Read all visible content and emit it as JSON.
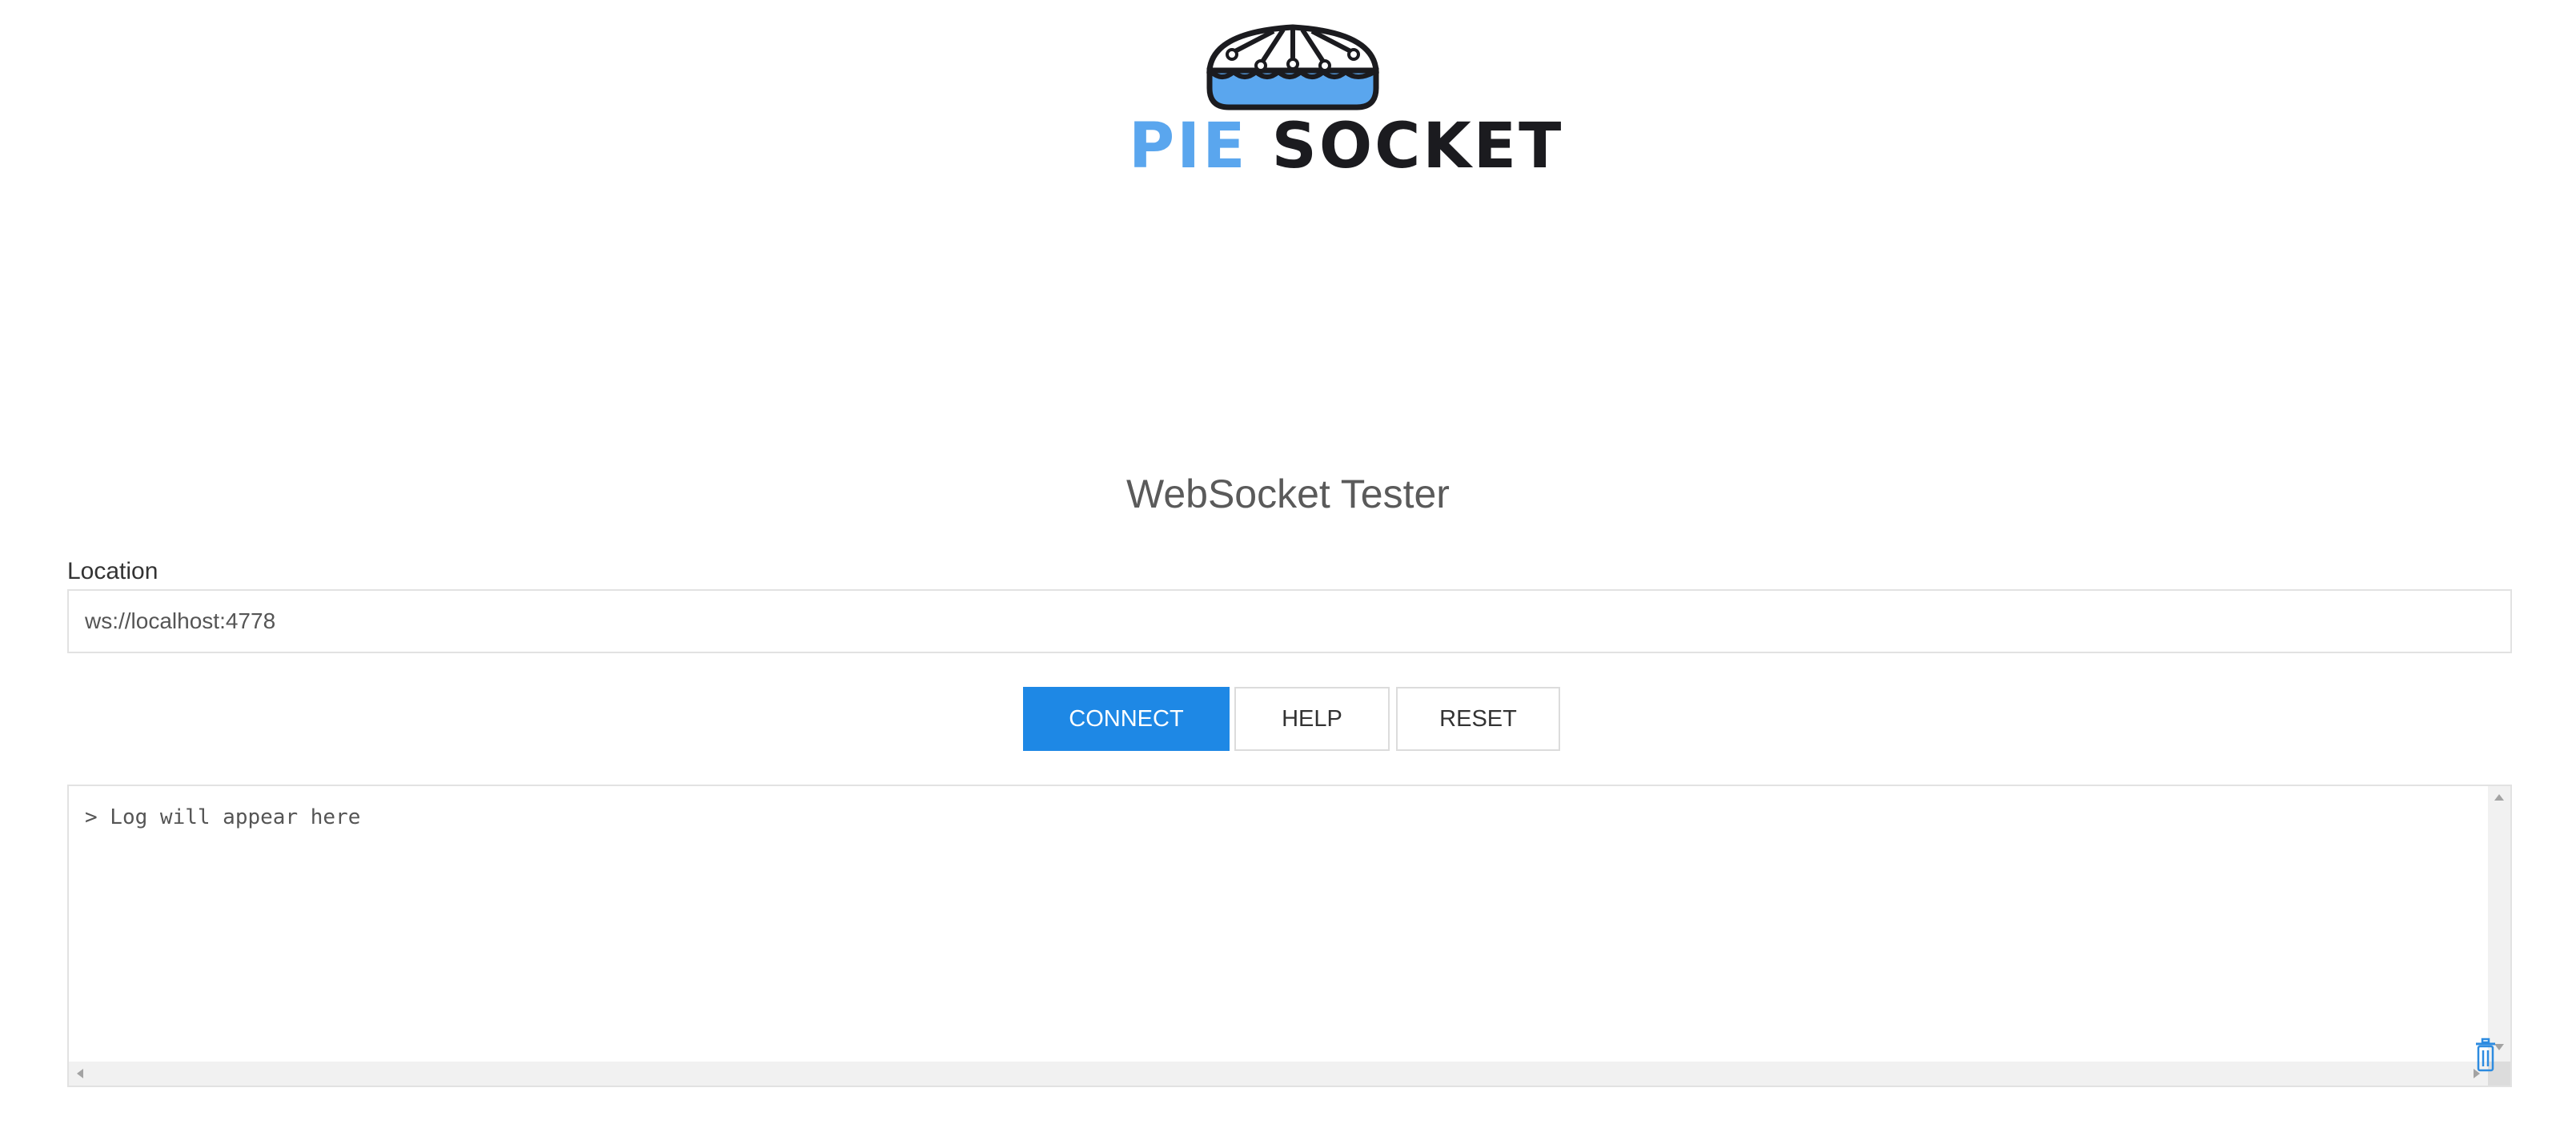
{
  "logo": {
    "word1": "PIE",
    "word2": "SOCKET",
    "primary_color": "#5aa6ee",
    "dark_color": "#1b1b1f"
  },
  "title": "WebSocket Tester",
  "location": {
    "label": "Location",
    "value": "ws://localhost:4778"
  },
  "buttons": {
    "connect": "CONNECT",
    "help": "HELP",
    "reset": "RESET",
    "connect_color": "#1e88e5"
  },
  "log": {
    "placeholder": "> Log will appear here",
    "clear_icon": "trash-icon"
  }
}
